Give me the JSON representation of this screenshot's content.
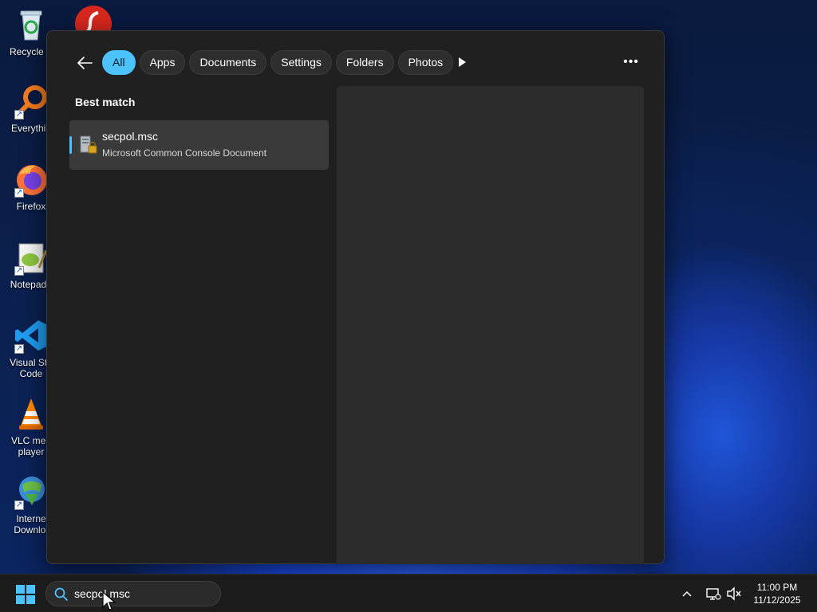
{
  "desktop": {
    "icons": [
      {
        "label": "Recycle B",
        "icon": "recycle-bin-icon"
      },
      {
        "label": "Everythin",
        "icon": "everything-search-icon"
      },
      {
        "label": "Firefox",
        "icon": "firefox-icon"
      },
      {
        "label": "Notepad+",
        "icon": "notepad-plus-plus-icon"
      },
      {
        "label": "Visual Stu Code",
        "icon": "vscode-icon"
      },
      {
        "label": "VLC med player",
        "icon": "vlc-icon"
      },
      {
        "label": "Interne Downlo.",
        "icon": "internet-download-manager-icon"
      }
    ]
  },
  "search_flyout": {
    "filters": [
      {
        "label": "All",
        "active": true
      },
      {
        "label": "Apps",
        "active": false
      },
      {
        "label": "Documents",
        "active": false
      },
      {
        "label": "Settings",
        "active": false
      },
      {
        "label": "Folders",
        "active": false
      },
      {
        "label": "Photos",
        "active": false
      }
    ],
    "section_title": "Best match",
    "best_match": {
      "name": "secpol.msc",
      "description": "Microsoft Common Console Document",
      "icon": "msc-console-icon"
    }
  },
  "taskbar": {
    "search_value": "secpol.msc",
    "time": "11:00 PM",
    "date": "11/12/2025"
  },
  "colors": {
    "accent": "#4cc2ff",
    "flyout_bg": "#202020",
    "preview_bg": "#2c2c2c",
    "taskbar_bg": "#1c1c1c"
  }
}
